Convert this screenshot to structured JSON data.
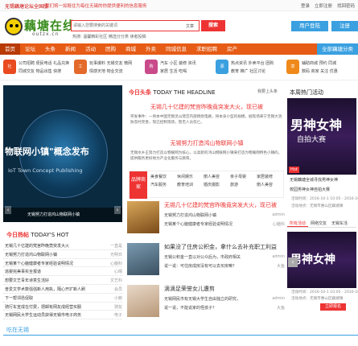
{
  "topbar": {
    "welcome": "无锡藕塘论坛全国版",
    "notice": "我们将一如既往为每位无锡的你提供便利的信息服务",
    "links": [
      "登录",
      "立即注册",
      "找回密码"
    ]
  },
  "logo": {
    "name": "藕塘在线",
    "domain": "outzx.cn"
  },
  "search": {
    "placeholder": "请输入您要搜索的关键词",
    "scope": "文章",
    "button": "搜索",
    "hot_label": "热搜:",
    "hot_terms": "温馨精彩社区  精选分分类  读者投稿"
  },
  "actions": {
    "login": "用户登陆",
    "register": "注册"
  },
  "mainnav": [
    "首页",
    "论坛",
    "头条",
    "新闻",
    "活动",
    "团购",
    "商城",
    "外卖",
    "同城信息",
    "求职招聘",
    "房产",
    "全部藕塘分类"
  ],
  "subnav": [
    {
      "icon": "社",
      "color": "#e94a1f",
      "rows": [
        "公司招聘  便民电话  礼品兑换",
        "同城交友  物品出售  快搜"
      ]
    },
    {
      "icon": "工",
      "color": "#e36a2a",
      "rows": [
        "玩事爆料  无锡交友  微网",
        "情感天地  物业交流"
      ]
    },
    {
      "icon": "购",
      "color": "#c94a8a",
      "rows": [
        "汽车  小区  装修  资讯",
        "家居  生活  吃喝"
      ]
    },
    {
      "icon": "源",
      "color": "#3aa0e0",
      "rows": [
        "热点资讯  外卖平台  团购",
        "教育  推广  社区讨论"
      ]
    },
    {
      "icon": "享",
      "color": "#ef8a1a",
      "rows": [
        "辅助商城  预约  同城",
        "数码  商家  关注  优惠"
      ]
    }
  ],
  "slider": {
    "headline": "物联网小镇\"概念发布",
    "english": "IoT Town Concept Publishing",
    "caption": "无锡努力打造鸿山物联网小镇"
  },
  "hot_today": {
    "title_cn": "今日热帖",
    "title_en": "TODAY'S HOT",
    "items": [
      {
        "t": "无锡几十亿建的梵宫昨晚竟突发大火",
        "d": "一直是"
      },
      {
        "t": "无锡努力打造鸿山物联网小镇",
        "d": "光明日"
      },
      {
        "t": "无锡某个心脑健康者专家经验说明情况",
        "d": "心脑科"
      },
      {
        "t": "逃婴完美事实全报道",
        "d": "心晴"
      },
      {
        "t": "想要文艺青年诗意生活好",
        "d": "文艺科"
      },
      {
        "t": "普爱文学术数强强新人用执，隔心开扩新人刷",
        "d": "会员"
      },
      {
        "t": "下一帮邻邑促取",
        "d": "小鲍"
      },
      {
        "t": "骑行车宣成在付费，把邮有网友成经营买服",
        "d": "骑友"
      },
      {
        "t": "无锡网民大学生运动员获得无锡市电子商务",
        "d": "电子"
      }
    ]
  },
  "headline": {
    "title_cn": "今日头条",
    "title_en": "TODAY THE HEADLINE",
    "more": "我要上头条",
    "main": "无锡几十亿建的梵宫昨晚竟突发大火，现已被",
    "summary": "突发事件：一男本中国无锡灵山梵宫内部燃烧电路，将本身小型的规模，据现场来宁无锡大消防及时完善，现已控制现场，暂无人员伤亡。",
    "sub": "无锡努力打造鸿山物联网小镇",
    "sub_summary": "无锡水乡正努力打造以物联网为核心，以高新的鸿山物联网小镇来打造为物联网特色小镇的，提供服务更好地为产业化服务与教育。"
  },
  "brand": {
    "tag": "品牌商家",
    "items": [
      "美食餐饮",
      "休闲娱乐",
      "丽人美容",
      "亲子母婴",
      "家居装修",
      "汽车服务",
      "教育培训",
      "婚庆摄影",
      "旅游",
      "丽人美容"
    ]
  },
  "news": [
    {
      "title": "无锡几十亿建的梵宫昨晚竟突发大火，现已被",
      "s1": "无锡努力打造鸿山物联网小镇",
      "s2": "无锡某个心脑健康者专家经验说明情况",
      "r1": "admin",
      "r2": "心脑科"
    },
    {
      "title": "如果没了住房公积金，拿什么去补充职工利益",
      "s1": "无锡公积金一直以对公众后为，市政府相关",
      "s2": "说一说：可住房成房没有可以去买房嘛？",
      "r1": "admin",
      "r2": "大鱼"
    },
    {
      "title": "滴滴足荣誉女儿遭剪",
      "s1": "无锡网民市有无锡大学生自由独立的研究，",
      "s2": "说一说，不能说家的怪孩子？",
      "r1": "admin",
      "r2": "大鱼"
    }
  ],
  "activity": {
    "title": "本周热门活动",
    "img_text1": "男神女神",
    "img_text2": "自拍大赛",
    "hot_tag": "Hot",
    "caption": "无锡藕塘全城寻找男神女神",
    "caption2": "校园男神女神自拍大赛",
    "meta1": "活动时间：2016-10-1 10:05 - 2016-10-1",
    "meta2": "活动地点：无锡市惠山区藕塘镇",
    "tabs": [
      "所有活动",
      "网络交友",
      "无锡车活"
    ],
    "meta3": "活动时间：2016-10-1 10:05 - 2016-10-1",
    "meta4": "活动地点：无锡市惠山区藕塘镇",
    "enroll": "立即报名"
  },
  "eat": {
    "title": "吃在无锡"
  }
}
